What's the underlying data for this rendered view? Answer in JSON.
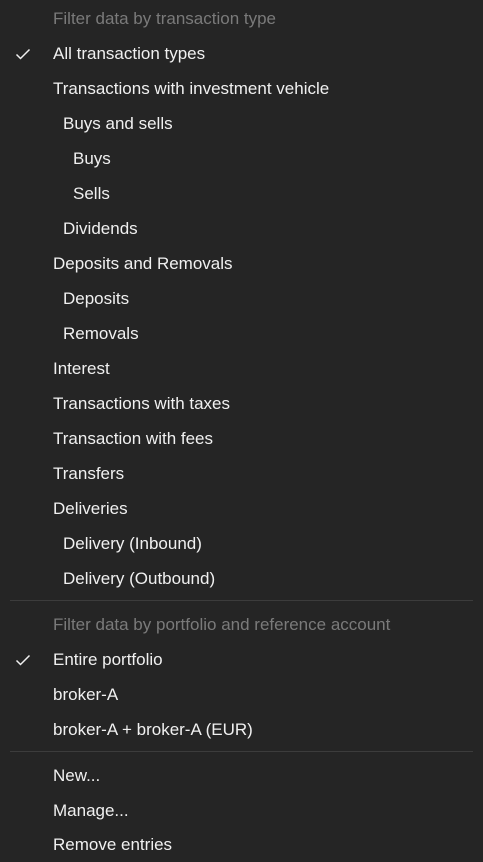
{
  "transaction_type_section": {
    "header": "Filter data by transaction type",
    "items": [
      "All transaction types",
      "Transactions with investment vehicle",
      "Buys and sells",
      "Buys",
      "Sells",
      "Dividends",
      "Deposits and Removals",
      "Deposits",
      "Removals",
      "Interest",
      "Transactions with taxes",
      "Transaction with fees",
      "Transfers",
      "Deliveries",
      "Delivery (Inbound)",
      "Delivery (Outbound)"
    ],
    "checked_item": "All transaction types"
  },
  "portfolio_section": {
    "header": "Filter data by portfolio and reference account",
    "items": [
      "Entire portfolio",
      "broker-A",
      "broker-A + broker-A (EUR)"
    ],
    "checked_item": "Entire portfolio"
  },
  "actions_section": {
    "items": [
      "New...",
      "Manage...",
      "Remove entries"
    ]
  },
  "icons": {
    "check": "check-icon"
  },
  "colors": {
    "background": "#252525",
    "text": "#f0f0f0",
    "header_text": "#7a7a7a",
    "separator": "#3c3c3c"
  }
}
